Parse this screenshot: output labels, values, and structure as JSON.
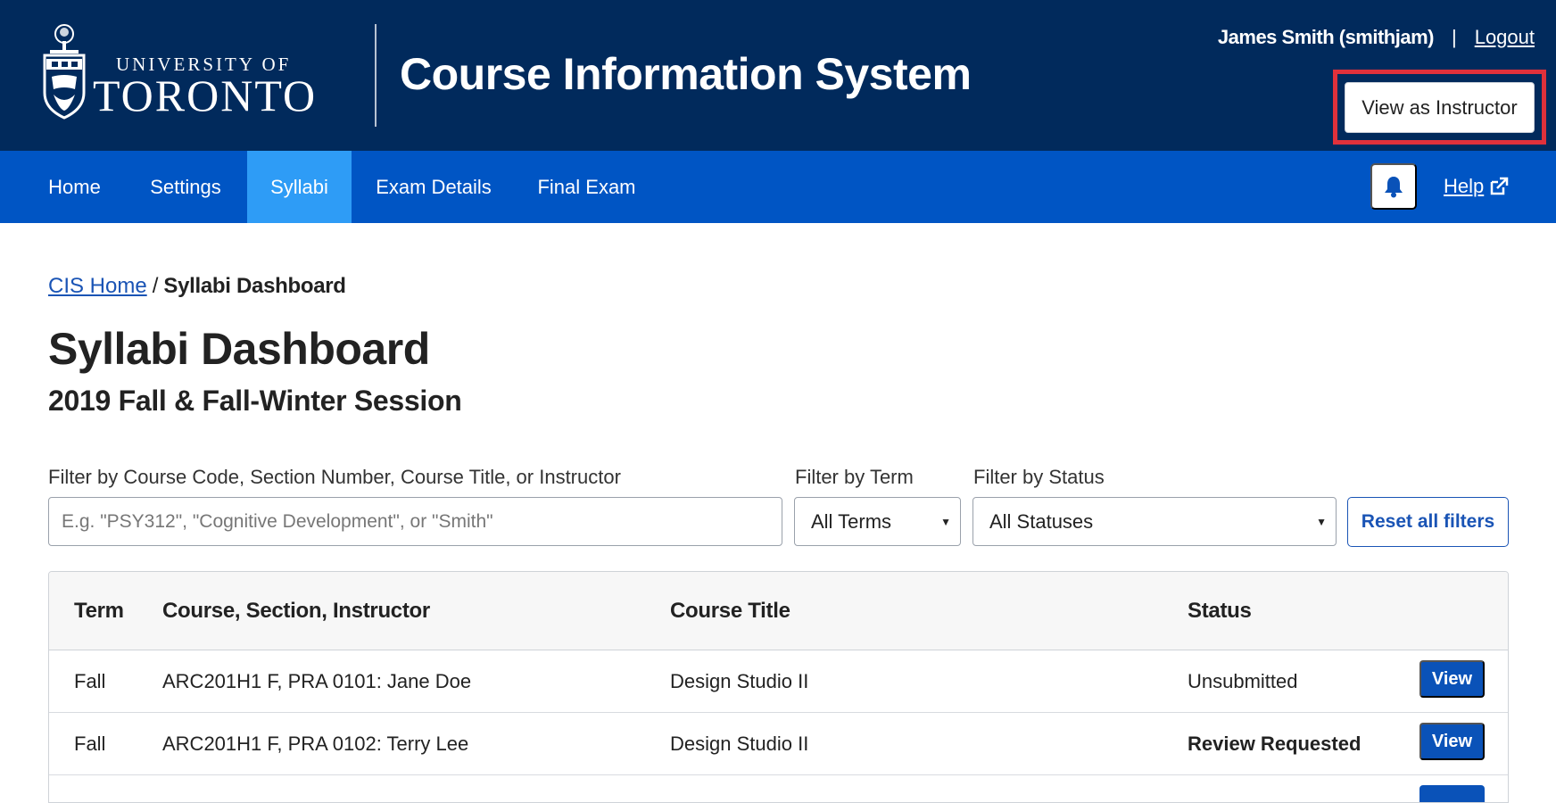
{
  "header": {
    "logo_line1": "UNIVERSITY OF",
    "logo_line2": "TORONTO",
    "app_title": "Course Information System",
    "user_name": "James Smith (smithjam)",
    "separator": "|",
    "logout_label": "Logout",
    "view_as_label": "View as Instructor"
  },
  "nav": {
    "items": [
      {
        "label": "Home"
      },
      {
        "label": "Settings"
      },
      {
        "label": "Syllabi",
        "active": true
      },
      {
        "label": "Exam Details"
      },
      {
        "label": "Final Exam"
      }
    ],
    "help_label": "Help",
    "bell_icon": "bell-icon",
    "external_icon": "external-link-icon"
  },
  "breadcrumb": {
    "home": "CIS Home",
    "separator": "/",
    "current": "Syllabi Dashboard"
  },
  "page": {
    "title": "Syllabi Dashboard",
    "subtitle": "2019 Fall & Fall-Winter Session"
  },
  "filters": {
    "search_label": "Filter by Course Code, Section Number, Course Title, or Instructor",
    "search_placeholder": "E.g. \"PSY312\", \"Cognitive Development\", or \"Smith\"",
    "term_label": "Filter by Term",
    "term_value": "All Terms",
    "status_label": "Filter by Status",
    "status_value": "All Statuses",
    "reset_label": "Reset all filters"
  },
  "table": {
    "headers": {
      "term": "Term",
      "course": "Course, Section, Instructor",
      "title": "Course Title",
      "status": "Status"
    },
    "rows": [
      {
        "term": "Fall",
        "course": "ARC201H1 F, PRA 0101: Jane Doe",
        "title": "Design Studio II",
        "status": "Unsubmitted",
        "action": "View"
      },
      {
        "term": "Fall",
        "course": "ARC201H1 F, PRA 0102: Terry Lee",
        "title": "Design Studio II",
        "status": "Review Requested",
        "action": "View"
      }
    ]
  },
  "colors": {
    "header_bg": "#012a5c",
    "nav_bg": "#0055c4",
    "nav_active": "#2e9cf6",
    "link": "#1a54b5",
    "highlight": "#e0313b"
  }
}
